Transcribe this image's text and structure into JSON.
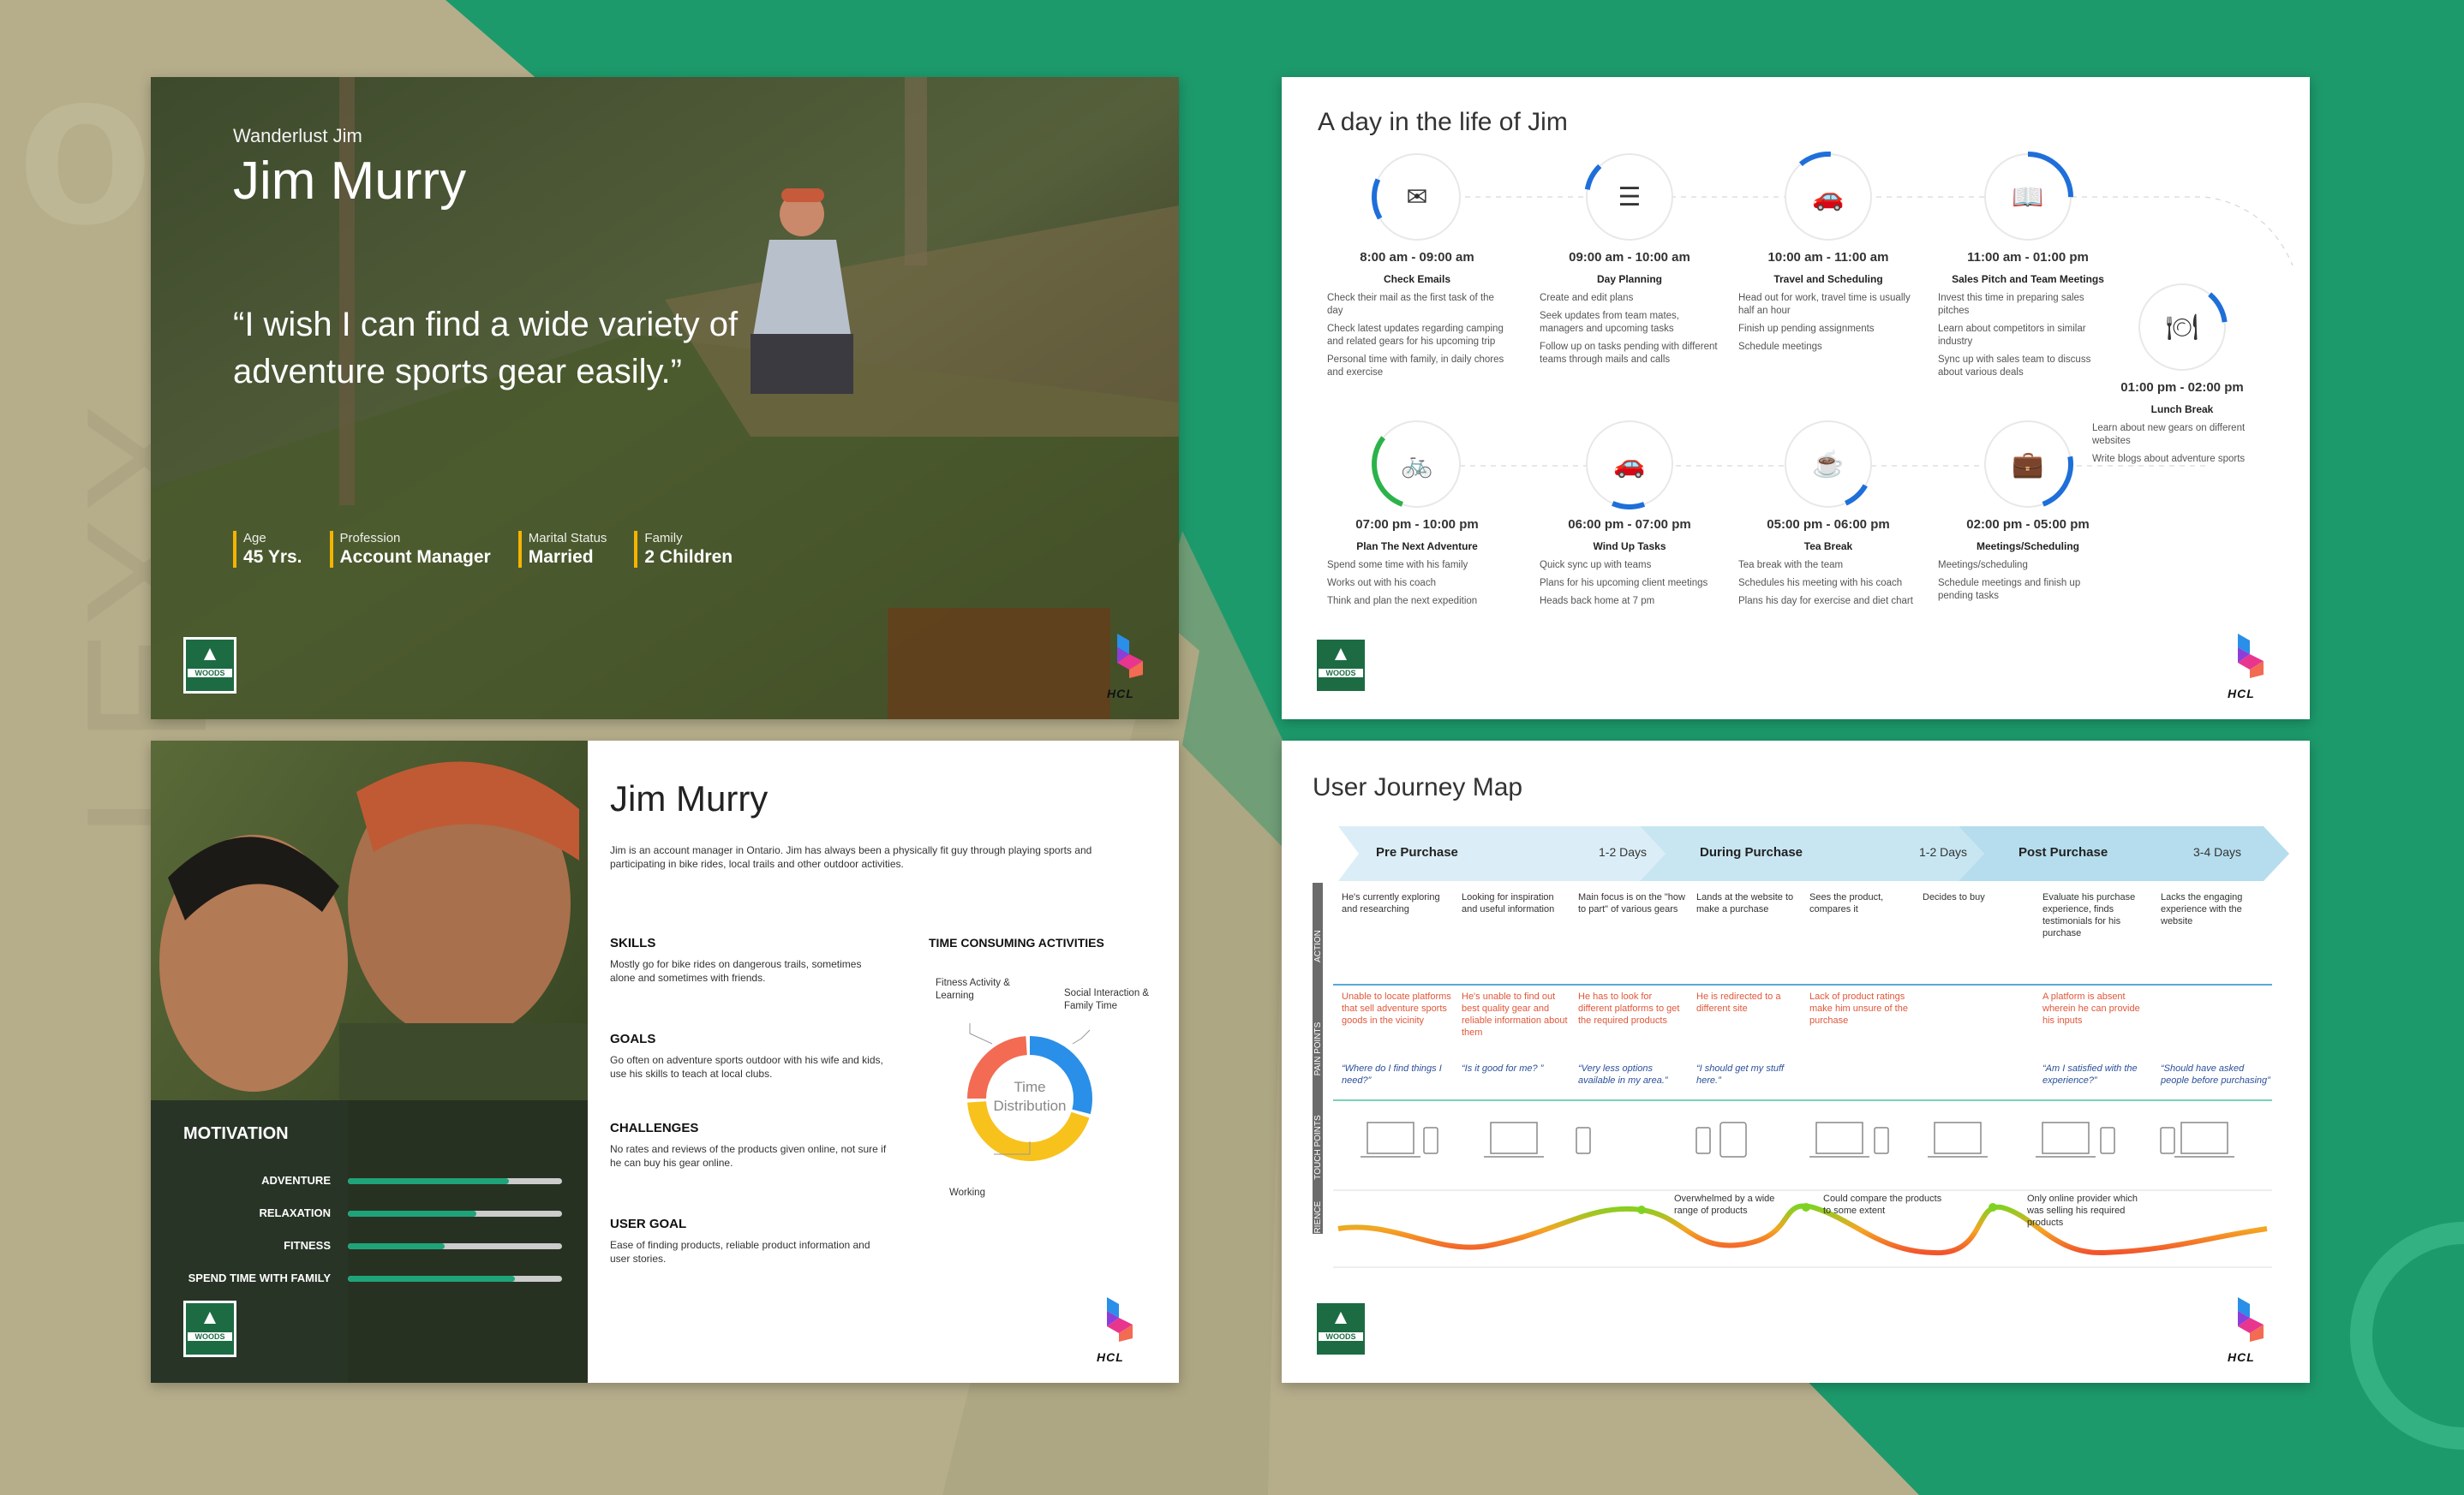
{
  "colors": {
    "brand_green": "#1d9a6c",
    "woods_green": "#1d6b43",
    "accent_yellow": "#f4b400",
    "blue": "#1e6fd9"
  },
  "woods_logo": {
    "label": "WOODS"
  },
  "hcl_logo": {
    "label": "HCL"
  },
  "persona": {
    "nickname": "Wanderlust Jim",
    "name": "Jim Murry",
    "quote": "“I wish I can find a wide variety of adventure sports gear easily.”",
    "facts": [
      {
        "key": "Age",
        "value": "45 Yrs."
      },
      {
        "key": "Profession",
        "value": "Account Manager"
      },
      {
        "key": "Marital Status",
        "value": "Married"
      },
      {
        "key": "Family",
        "value": "2 Children"
      }
    ]
  },
  "day": {
    "title": "A day in the life of Jim",
    "steps": [
      {
        "icon": "mail-icon",
        "time": "8:00 am - 09:00 am",
        "label": "Check Emails",
        "progress": 0.15,
        "items": [
          "Check their mail as the first task of the day",
          "Check latest updates regarding camping and related gears for his upcoming trip",
          "Personal time with family, in  daily chores and exercise"
        ]
      },
      {
        "icon": "checklist-icon",
        "time": "09:00 am - 10:00 am",
        "label": "Day Planning",
        "progress": 0.1,
        "items": [
          "Create and edit plans",
          "Seek updates from team mates, managers  and upcoming tasks",
          "Follow up on tasks pending with different teams through mails and calls"
        ]
      },
      {
        "icon": "car-icon",
        "time": "10:00 am - 11:00 am",
        "label": "Travel and Scheduling",
        "progress": 0.12,
        "items": [
          "Head out  for work, travel time is usually half an hour",
          "Finish up pending assignments",
          "Schedule meetings"
        ]
      },
      {
        "icon": "book-icon",
        "time": "11:00 am - 01:00 pm",
        "label": "Sales Pitch and Team Meetings",
        "progress": 0.25,
        "items": [
          "Invest this time in preparing sales pitches",
          "Learn about competitors in similar industry",
          "Sync up with sales team to discuss about various deals"
        ]
      },
      {
        "icon": "food-tray-icon",
        "time": "01:00 pm - 02:00 pm",
        "label": "Lunch Break",
        "progress": 0.12,
        "items": [
          "Learn about new gears on different websites",
          "Write blogs about adventure sports"
        ]
      },
      {
        "icon": "briefcase-icon",
        "time": "02:00 pm - 05:00 pm",
        "label": "Meetings/Scheduling",
        "progress": 0.22,
        "items": [
          "Meetings/scheduling",
          "Schedule meetings and finish up pending tasks"
        ]
      },
      {
        "icon": "tea-cup-icon",
        "time": "05:00 pm - 06:00 pm",
        "label": "Tea Break",
        "progress": 0.1,
        "items": [
          "Tea break with the team",
          "Schedules his meeting with his coach",
          "Plans his day for exercise and diet chart"
        ]
      },
      {
        "icon": "car-icon",
        "time": "06:00 pm - 07:00 pm",
        "label": "Wind Up Tasks",
        "progress": 0.12,
        "items": [
          "Quick sync up with teams",
          "Plans for his upcoming client meetings",
          "Heads back home at 7 pm"
        ]
      },
      {
        "icon": "bike-icon",
        "time": "07:00 pm - 10:00 pm",
        "label": "Plan The Next Adventure",
        "progress": 0.3,
        "items": [
          "Spend some time with his family",
          "Works out with his coach",
          "Think and plan the next expedition"
        ]
      }
    ]
  },
  "profile": {
    "name": "Jim Murry",
    "intro": "Jim is an account manager in Ontario. Jim has always been a physically fit guy through playing sports and participating in bike rides, local trails and other outdoor activities.",
    "sections": [
      {
        "title": "SKILLS",
        "text": "Mostly go for bike rides on dangerous trails, sometimes alone and sometimes with friends."
      },
      {
        "title": "GOALS",
        "text": "Go often on adventure sports outdoor with his wife and kids, use his skills to teach at local clubs."
      },
      {
        "title": "CHALLENGES",
        "text": "No rates and reviews of the products given online, not sure if he can buy his gear online."
      },
      {
        "title": "USER GOAL",
        "text": "Ease of finding products, reliable product information and user stories."
      }
    ],
    "motivation": {
      "title": "MOTIVATION",
      "items": [
        {
          "label": "ADVENTURE",
          "value": 0.75
        },
        {
          "label": "RELAXATION",
          "value": 0.6
        },
        {
          "label": "FITNESS",
          "value": 0.45
        },
        {
          "label": "SPEND TIME WITH FAMILY",
          "value": 0.78
        }
      ]
    },
    "activities": {
      "title": "TIME CONSUMING ACTIVITIES",
      "center": [
        "Time",
        "Distribution"
      ],
      "segments": [
        {
          "label": "Social Interaction & Family Time",
          "value": 0.3,
          "color": "#2a8fe8"
        },
        {
          "label": "Working",
          "value": 0.45,
          "color": "#f8c21c"
        },
        {
          "label": "Fitness Activity & Learning",
          "value": 0.25,
          "color": "#f26b52"
        }
      ]
    }
  },
  "journey": {
    "title": "User Journey Map",
    "phases": [
      {
        "name": "Pre Purchase",
        "duration": "1-2 Days"
      },
      {
        "name": "During Purchase",
        "duration": "1-2 Days"
      },
      {
        "name": "Post Purchase",
        "duration": "3-4 Days"
      }
    ],
    "row_labels": [
      "ACTION",
      "PAIN POINTS",
      "TOUCH POINTS",
      "EXPERIENCE"
    ],
    "actions": [
      "He's currently exploring and researching",
      "Looking for inspiration and useful information",
      "Main focus is on the \"how to part\" of various gears",
      "Lands at the website to make a purchase",
      "Sees the product, compares it",
      "Decides to buy",
      "Evaluate his purchase experience, finds testimonials for his purchase",
      "Lacks the engaging experience with the website"
    ],
    "pains": [
      "Unable to locate platforms that sell adventure sports goods in the vicinity",
      "He's unable to find out best quality gear and reliable information about them",
      "He has to look for different platforms to get the required products",
      "He is redirected to a different site",
      "Lack of product ratings make him unsure of the purchase",
      "",
      "A platform is absent wherein he can provide his inputs",
      ""
    ],
    "quotes": [
      "“Where do I find things I need?”",
      "“Is it good for me? ”",
      "“Very less options available in my area.”",
      "“I should get my stuff here.”",
      "",
      "",
      "“Am I satisfied with the experience?”",
      "“Should have asked people before purchasing”"
    ],
    "experience_notes": [
      "Overwhelmed by a wide range of products",
      "Could compare the products to some extent",
      "Only online provider which was selling his required products"
    ]
  }
}
